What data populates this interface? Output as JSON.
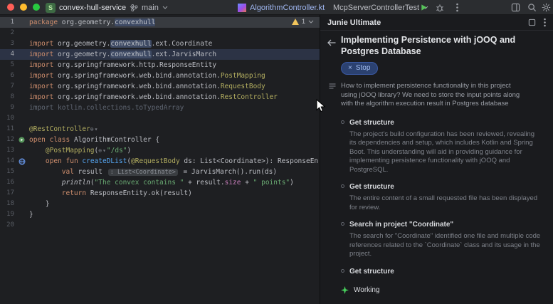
{
  "titlebar": {
    "project_icon_letter": "S",
    "project_name": "convex-hull-service",
    "branch_name": "main",
    "file_tab": "AlgorithmController.kt",
    "run_config": "McpServerControllerTest"
  },
  "editor": {
    "inspection_count": "1",
    "lines": [
      {
        "n": "1",
        "bg": "caret",
        "t": [
          [
            "kw",
            "package "
          ],
          [
            "txt",
            "org.geometry."
          ],
          [
            "hl",
            "convexhull"
          ]
        ]
      },
      {
        "n": "2",
        "t": []
      },
      {
        "n": "3",
        "t": [
          [
            "kw",
            "import "
          ],
          [
            "txt",
            "org.geometry."
          ],
          [
            "hl",
            "convexhull"
          ],
          [
            "txt",
            ".ext.Coordinate"
          ]
        ]
      },
      {
        "n": "4",
        "bg": "select",
        "t": [
          [
            "kw",
            "import "
          ],
          [
            "txt",
            "org.geometry."
          ],
          [
            "hl",
            "convexhull"
          ],
          [
            "txt",
            ".ext.JarvisMarch"
          ]
        ]
      },
      {
        "n": "5",
        "t": [
          [
            "kw",
            "import "
          ],
          [
            "txt",
            "org.springframework.http.ResponseEntity"
          ]
        ]
      },
      {
        "n": "6",
        "t": [
          [
            "kw",
            "import "
          ],
          [
            "txt",
            "org.springframework.web.bind.annotation."
          ],
          [
            "ann",
            "PostMapping"
          ]
        ]
      },
      {
        "n": "7",
        "t": [
          [
            "kw",
            "import "
          ],
          [
            "txt",
            "org.springframework.web.bind.annotation."
          ],
          [
            "ann",
            "RequestBody"
          ]
        ]
      },
      {
        "n": "8",
        "t": [
          [
            "kw",
            "import "
          ],
          [
            "txt",
            "org.springframework.web.bind.annotation."
          ],
          [
            "ann",
            "RestController"
          ]
        ]
      },
      {
        "n": "9",
        "t": [
          [
            "gray",
            "import kotlin.collections.toTypedArray"
          ]
        ]
      },
      {
        "n": "10",
        "t": []
      },
      {
        "n": "11",
        "t": [
          [
            "ann",
            "@RestController"
          ],
          [
            "icon",
            "⊕▾"
          ]
        ]
      },
      {
        "n": "12",
        "g": "run",
        "t": [
          [
            "kw",
            "open "
          ],
          [
            "kw",
            "class "
          ],
          [
            "txt",
            "AlgorithmController {"
          ]
        ]
      },
      {
        "n": "13",
        "t": [
          [
            "txt",
            "    "
          ],
          [
            "ann",
            "@PostMapping"
          ],
          [
            "txt",
            "("
          ],
          [
            "icon",
            "⊕▾"
          ],
          [
            "str",
            "\"/ds\""
          ],
          [
            "txt",
            ")"
          ]
        ]
      },
      {
        "n": "14",
        "g": "globe",
        "t": [
          [
            "txt",
            "    "
          ],
          [
            "kw",
            "open "
          ],
          [
            "kw",
            "fun "
          ],
          [
            "fn",
            "createDList"
          ],
          [
            "txt",
            "("
          ],
          [
            "ann",
            "@RequestBody"
          ],
          [
            "txt",
            " ds: List<Coordinate>): ResponseEn"
          ]
        ]
      },
      {
        "n": "15",
        "t": [
          [
            "txt",
            "        "
          ],
          [
            "kw",
            "val "
          ],
          [
            "txt",
            "result "
          ],
          [
            "inlay",
            ": List<Coordinate>"
          ],
          [
            "txt",
            " = JarvisMarch().run(ds)"
          ]
        ]
      },
      {
        "n": "16",
        "t": [
          [
            "txt",
            "        "
          ],
          [
            "it",
            "println"
          ],
          [
            "txt",
            "("
          ],
          [
            "str",
            "\"The convex contains \""
          ],
          [
            "txt",
            " + result."
          ],
          [
            "prop",
            "size"
          ],
          [
            "txt",
            " + "
          ],
          [
            "str",
            "\" points\""
          ],
          [
            "txt",
            ")"
          ]
        ]
      },
      {
        "n": "17",
        "t": [
          [
            "txt",
            "        "
          ],
          [
            "kw",
            "return "
          ],
          [
            "txt",
            "ResponseEntity.ok(result)"
          ]
        ]
      },
      {
        "n": "18",
        "t": [
          [
            "txt",
            "    }"
          ]
        ]
      },
      {
        "n": "19",
        "t": [
          [
            "txt",
            "}"
          ]
        ]
      },
      {
        "n": "20",
        "t": []
      }
    ]
  },
  "junie": {
    "panel_title": "Junie Ultimate",
    "task_title": "Implementing Persistence with jOOQ and Postgres Database",
    "stop_label": "Stop",
    "question": "How to implement persistence functionality in this project using jOOQ library? We need to store the input points along with the algorithm execution result in Postgres database",
    "steps": [
      {
        "title": "Get structure",
        "body": "The project's build configuration has been reviewed, revealing its dependencies and setup, which includes Kotlin and Spring Boot. This understanding will aid in providing guidance for implementing persistence functionality with jOOQ and PostgreSQL."
      },
      {
        "title": "Get structure",
        "body": "The entire content of a small requested file has been displayed for review."
      },
      {
        "title": "Search in project \"Coordinate\"",
        "body": "The search for \"Coordinate\" identified one file and multiple code references related to the `Coordinate` class and its usage in the project."
      },
      {
        "title": "Get structure",
        "body": ""
      }
    ],
    "status_label": "Working"
  }
}
